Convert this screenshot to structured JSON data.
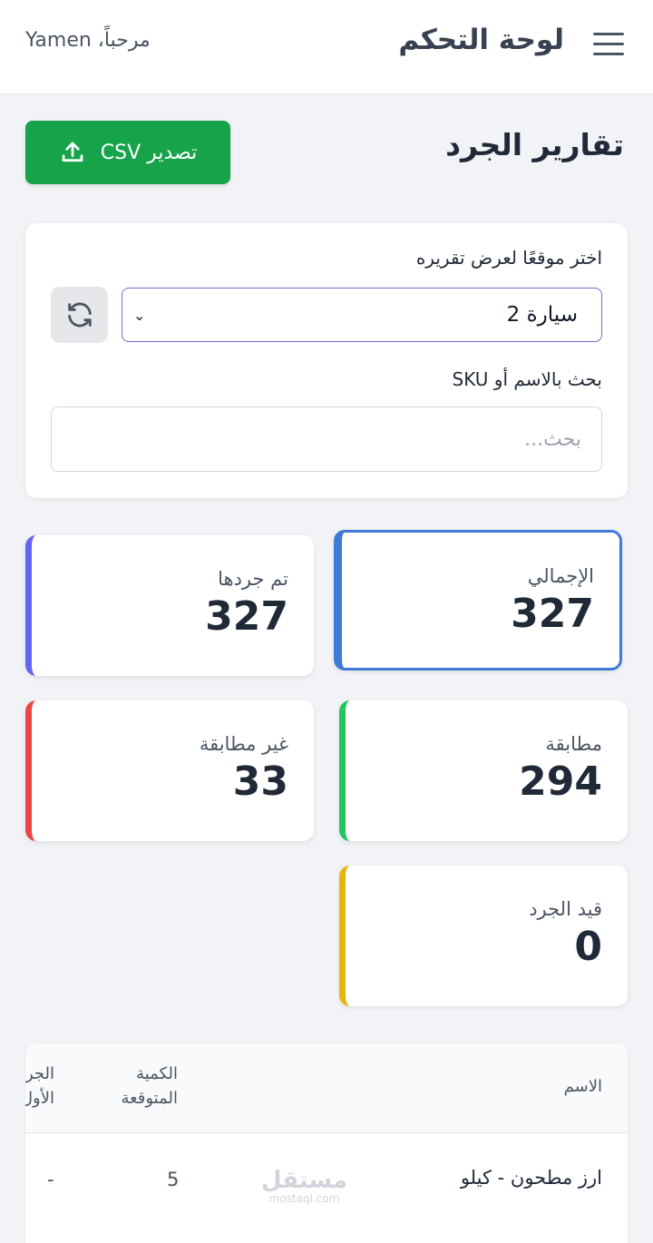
{
  "header": {
    "app_title": "لوحة التحكم",
    "welcome": "مرحباً، Yamen",
    "menu_icon": "hamburger-menu-icon"
  },
  "page": {
    "title": "تقارير الجرد",
    "export_label": "تصدير CSV",
    "export_icon": "upload-icon",
    "export_color": "#16a34a"
  },
  "filters": {
    "site_label": "اختر موقعًا لعرض تقريره",
    "site_selected": "سيارة 2",
    "refresh_icon": "refresh-icon",
    "search_label": "بحث بالاسم أو SKU",
    "search_placeholder": "بحث..."
  },
  "stats": [
    {
      "label": "الإجمالي",
      "value": "327",
      "color": "#3f7bd6",
      "active": true
    },
    {
      "label": "تم جردها",
      "value": "327",
      "color": "#6366f1",
      "active": false
    },
    {
      "label": "مطابقة",
      "value": "294",
      "color": "#22c55e",
      "active": false
    },
    {
      "label": "غير مطابقة",
      "value": "33",
      "color": "#ef4444",
      "active": false
    },
    {
      "label": "قيد الجرد",
      "value": "0",
      "color": "#eab308",
      "active": false
    }
  ],
  "table": {
    "columns": [
      "الاسم",
      "الكمية المتوقعة",
      "الجرد الأول"
    ],
    "rows": [
      {
        "name": "ارز مطحون - كيلو",
        "expected": "5",
        "first_count": "-"
      }
    ]
  },
  "watermark": {
    "text": "مستقل",
    "sub": "mostaql.com"
  }
}
